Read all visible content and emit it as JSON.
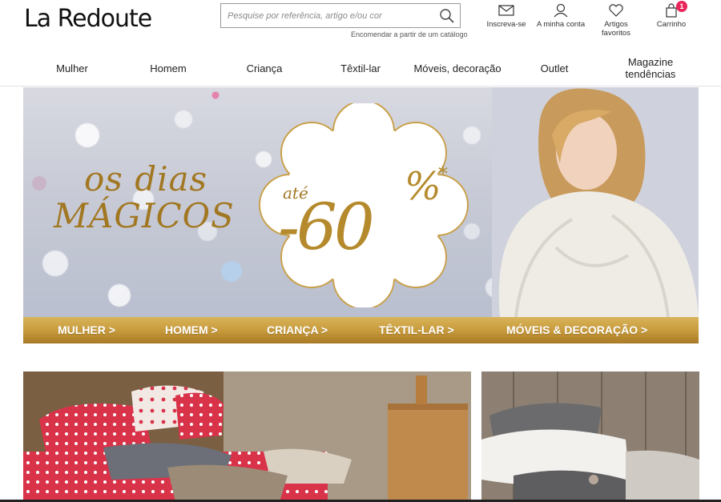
{
  "header": {
    "logo": "La Redoute",
    "search": {
      "placeholder": "Pesquise por referência, artigo e/ou cor"
    },
    "catalog_link": "Encomendar a partir de um catálogo",
    "utilities": [
      {
        "label": "Inscreva-se",
        "icon": "envelope-icon"
      },
      {
        "label": "A minha conta",
        "icon": "user-icon"
      },
      {
        "label": "Artigos favoritos",
        "icon": "heart-icon"
      },
      {
        "label": "Carrinho",
        "icon": "bag-icon",
        "badge": "1"
      }
    ]
  },
  "nav": {
    "items": [
      "Mulher",
      "Homem",
      "Criança",
      "Têxtil-lar",
      "Móveis, decoração",
      "Outlet",
      "Magazine tendências"
    ]
  },
  "hero": {
    "headline_line1": "os dias",
    "headline_line2": "MÁGICOS",
    "promo_prefix": "até",
    "promo_value": "-60",
    "promo_percent": "%",
    "promo_star": "*",
    "links": [
      "MULHER >",
      "HOMEM >",
      "CRIANÇA >",
      "TÊXTIL-LAR >",
      "MÓVEIS & DECORAÇÃO >"
    ]
  },
  "colors": {
    "gold": "#b58a2d",
    "gold_bar": "#c89b3c",
    "badge": "#e8265a",
    "polka_red": "#d9334a"
  }
}
